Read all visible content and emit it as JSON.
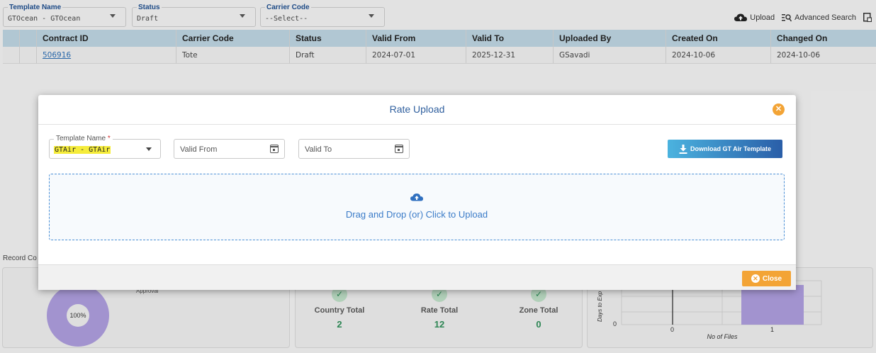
{
  "filters": [
    {
      "label": "Template Name",
      "value": "GTOcean - GTOcean"
    },
    {
      "label": "Status",
      "value": "Draft"
    },
    {
      "label": "Carrier Code",
      "value": "--Select--"
    }
  ],
  "toolbar": {
    "upload_label": "Upload",
    "advanced_search_label": "Advanced Search"
  },
  "grid": {
    "columns": [
      "Contract ID",
      "Carrier Code",
      "Status",
      "Valid From",
      "Valid To",
      "Uploaded By",
      "Created On",
      "Changed On"
    ],
    "rows": [
      [
        "506916",
        "Tote",
        "Draft",
        "2024-07-01",
        "2025-12-31",
        "GSavadi",
        "2024-10-06",
        "2024-10-06"
      ]
    ]
  },
  "record_count_label": "Record Co",
  "dashboard": {
    "pie_center": "100%",
    "pie_legend": "Approval",
    "stats": [
      {
        "label": "Country Total",
        "value": "2"
      },
      {
        "label": "Rate Total",
        "value": "12"
      },
      {
        "label": "Zone Total",
        "value": "0"
      }
    ],
    "bar_chart": {
      "ylabel": "Days to Exp",
      "xlabel": "No of Files",
      "y_tick": "0",
      "x_ticks": [
        "0",
        "1"
      ]
    }
  },
  "modal": {
    "title": "Rate Upload",
    "template_label": "Template Name",
    "template_value": "GTAir - GTAir",
    "valid_from_placeholder": "Valid From",
    "valid_to_placeholder": "Valid To",
    "download_label": "Download GT Air Template",
    "dropzone_text": "Drag and Drop (or) Click to Upload",
    "close_label": "Close"
  },
  "colors": {
    "accent_orange": "#f3a436",
    "link_blue": "#2b6cb0",
    "title_blue": "#2f5f9e"
  }
}
